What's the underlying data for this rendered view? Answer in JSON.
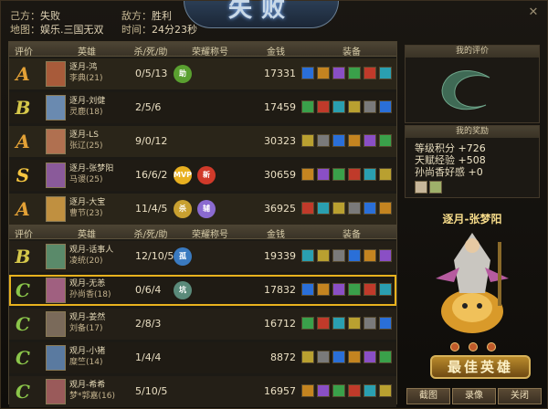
{
  "banner": "失败",
  "header": {
    "own_label": "己方：",
    "own_value": "失败",
    "enemy_label": "敌方：",
    "enemy_value": "胜利",
    "map_label": "地图：",
    "map_value": "娱乐.三国无双",
    "time_label": "时间：",
    "time_value": "24分23秒"
  },
  "columns": [
    "评价",
    "英雄",
    "杀/死/助",
    "荣耀称号",
    "金钱",
    "装备"
  ],
  "team1": [
    {
      "grade": "A",
      "name": "逐月-鸿",
      "hero": "李典(21)",
      "kda": "0/5/13",
      "honors": [
        "助"
      ],
      "gold": "17331"
    },
    {
      "grade": "B",
      "name": "逐月-刘健",
      "hero": "灵鹿(18)",
      "kda": "2/5/6",
      "honors": [],
      "gold": "17459"
    },
    {
      "grade": "A",
      "name": "逐月-LS",
      "hero": "张辽(25)",
      "kda": "9/0/12",
      "honors": [],
      "gold": "30323"
    },
    {
      "grade": "S",
      "name": "逐月-张梦阳",
      "hero": "马谡(25)",
      "kda": "16/6/2",
      "honors": [
        "MVP",
        "新"
      ],
      "gold": "30659"
    },
    {
      "grade": "A",
      "name": "逐月-大宝",
      "hero": "曹节(23)",
      "kda": "11/4/5",
      "honors": [
        "杀",
        "辅"
      ],
      "gold": "36925"
    }
  ],
  "team2": [
    {
      "grade": "B",
      "name": "观月-话事人",
      "hero": "凌统(20)",
      "kda": "12/10/5",
      "honors": [
        "孤"
      ],
      "gold": "19339"
    },
    {
      "grade": "C",
      "name": "观月-无恙",
      "hero": "孙尚香(18)",
      "kda": "0/6/4",
      "honors": [
        "坑"
      ],
      "gold": "17832"
    },
    {
      "grade": "C",
      "name": "观月-姜然",
      "hero": "刘备(17)",
      "kda": "2/8/3",
      "honors": [],
      "gold": "16712"
    },
    {
      "grade": "C",
      "name": "观月-小猪",
      "hero": "糜竺(14)",
      "kda": "1/4/4",
      "honors": [],
      "gold": "8872"
    },
    {
      "grade": "C",
      "name": "观月-希希",
      "hero": "梦*郭嘉(16)",
      "kda": "5/10/5",
      "honors": [],
      "gold": "16957"
    }
  ],
  "right": {
    "my_rating_title": "我的评价",
    "my_reward_title": "我的奖励",
    "rewards": [
      {
        "label": "等级积分",
        "value": "+726"
      },
      {
        "label": "天赋经验",
        "value": "+508"
      },
      {
        "label": "孙尚香好感",
        "value": "+0"
      }
    ],
    "best_hero_name": "逐月-张梦阳",
    "best_hero_button": "最佳英雄"
  },
  "buttons": {
    "screenshot": "截图",
    "replay": "录像",
    "close": "关闭"
  },
  "colors": {
    "highlight": "#e8b21e",
    "gold_text": "#f7dc8a"
  }
}
